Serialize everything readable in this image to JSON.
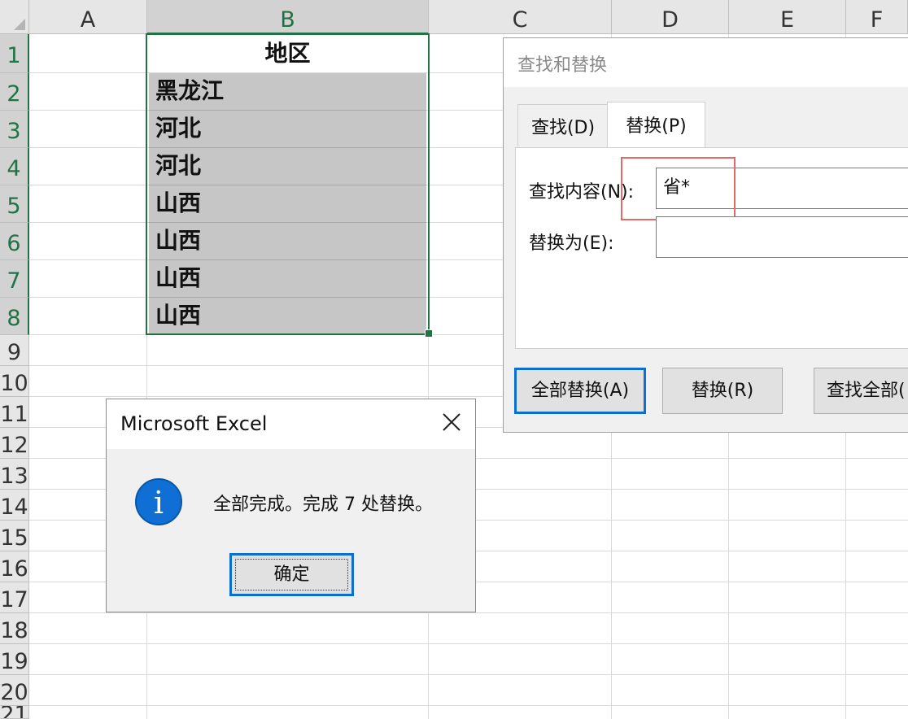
{
  "spreadsheet": {
    "columns": [
      "A",
      "B",
      "C",
      "D",
      "E",
      "F"
    ],
    "rows": [
      "1",
      "2",
      "3",
      "4",
      "5",
      "6",
      "7",
      "8",
      "9",
      "10",
      "11",
      "12",
      "13",
      "14",
      "15",
      "16",
      "17",
      "18",
      "19",
      "20",
      "21"
    ],
    "selected_column": "B",
    "header_cell": "地区",
    "data_cells": [
      "黑龙江",
      "河北",
      "河北",
      "山西",
      "山西",
      "山西",
      "山西"
    ]
  },
  "find_replace": {
    "title": "查找和替换",
    "tab_find": "查找(D)",
    "tab_replace": "替换(P)",
    "find_label": "查找内容(N):",
    "find_value": "省*",
    "replace_label": "替换为(E):",
    "replace_value": "",
    "replace_all_button": "全部替换(A)",
    "replace_button": "替换(R)",
    "find_all_button": "查找全部("
  },
  "message_box": {
    "title": "Microsoft Excel",
    "message": "全部完成。完成 7 处替换。",
    "ok_button": "确定",
    "icon": "info-icon"
  },
  "colors": {
    "excel_green": "#217346",
    "accent_blue": "#0b6fd0",
    "highlight_red": "#e46a6a",
    "selection_fill": "#c6c6c6"
  }
}
